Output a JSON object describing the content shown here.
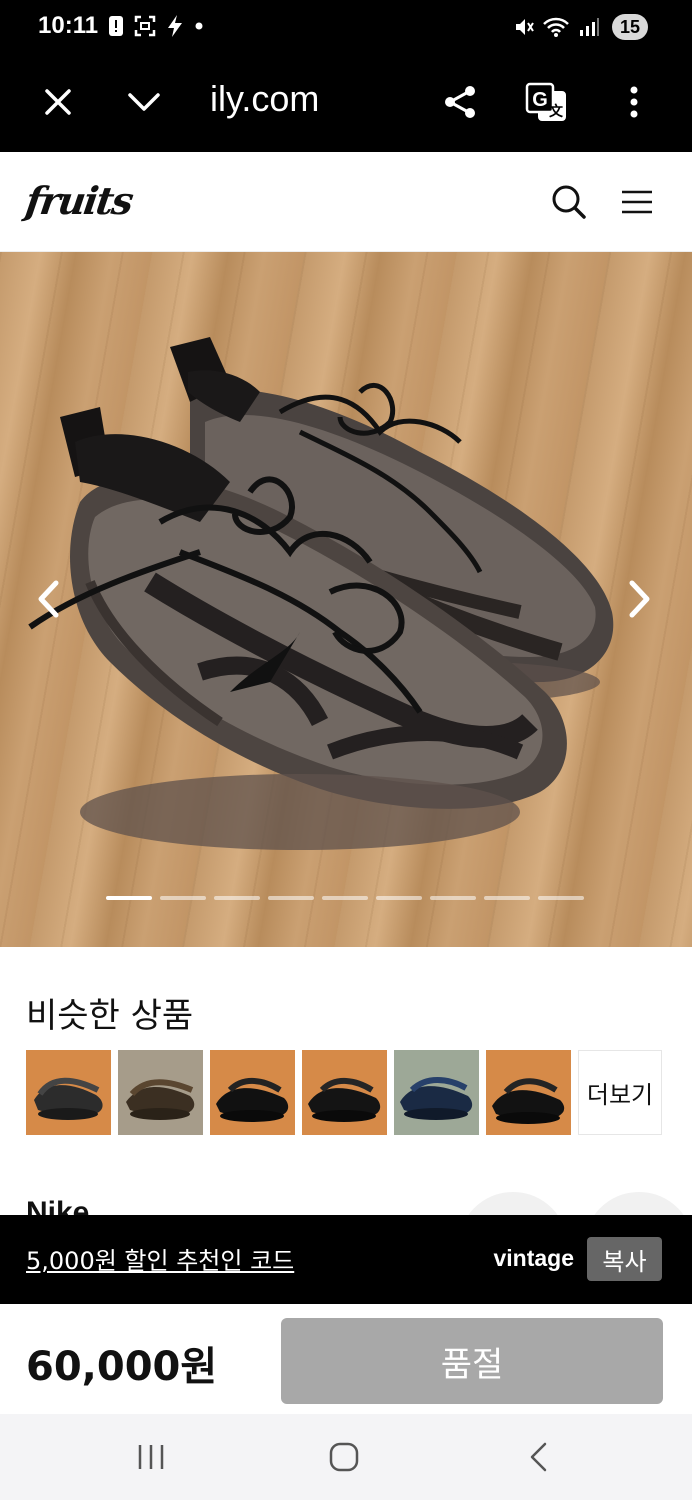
{
  "status_bar": {
    "time": "10:11",
    "notification_count": "15",
    "icons_left": [
      "alert-icon",
      "screenshot-icon",
      "flash-icon",
      "dot-icon"
    ],
    "icons_right": [
      "mute-icon",
      "wifi-icon",
      "signal-icon"
    ]
  },
  "browser": {
    "url": "ily.com",
    "buttons": [
      "close-icon",
      "chevron-down-icon",
      "share-icon",
      "translate-icon",
      "more-vertical-icon"
    ]
  },
  "header": {
    "logo": "fruits",
    "buttons": [
      "search-icon",
      "menu-icon"
    ]
  },
  "product_image": {
    "slides_total": 9,
    "active_slide": 1
  },
  "similar": {
    "title": "비슷한 상품",
    "thumbs": [
      "orange",
      "gray",
      "orange",
      "orange",
      "white",
      "orange"
    ],
    "more_label": "더보기"
  },
  "partial": {
    "brand": "Nike"
  },
  "coupon": {
    "text": "5,000원 할인 추천인 코드",
    "code": "vintage",
    "copy_label": "복사"
  },
  "purchase": {
    "price": "60,000원",
    "soldout_label": "품절"
  },
  "colors": {
    "bar_black": "#000000",
    "soldout_gray": "#a8a8a8",
    "copy_gray": "#666666"
  }
}
